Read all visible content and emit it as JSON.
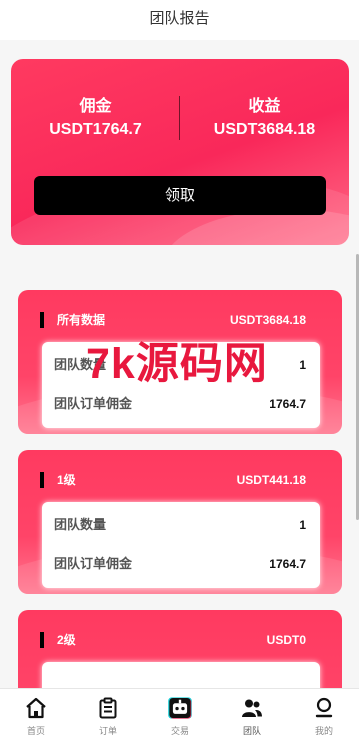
{
  "header": {
    "title": "团队报告"
  },
  "summary": {
    "commission_label": "佣金",
    "commission_value": "USDT1764.7",
    "earnings_label": "收益",
    "earnings_value": "USDT3684.18",
    "claim_label": "领取"
  },
  "cards": [
    {
      "label": "所有数据",
      "amount": "USDT3684.18",
      "rows": [
        {
          "label": "团队数量",
          "value": "1"
        },
        {
          "label": "团队订单佣金",
          "value": "1764.7"
        }
      ]
    },
    {
      "label": "1级",
      "amount": "USDT441.18",
      "rows": [
        {
          "label": "团队数量",
          "value": "1"
        },
        {
          "label": "团队订单佣金",
          "value": "1764.7"
        }
      ]
    },
    {
      "label": "2级",
      "amount": "USDT0",
      "rows": []
    }
  ],
  "watermark": "7k源码网",
  "tabbar": [
    {
      "label": "首页",
      "icon": "home-icon"
    },
    {
      "label": "订单",
      "icon": "clipboard-icon"
    },
    {
      "label": "交易",
      "icon": "robot-icon"
    },
    {
      "label": "团队",
      "icon": "team-icon",
      "active": true
    },
    {
      "label": "我的",
      "icon": "profile-icon"
    }
  ],
  "colors": {
    "accent": "#ff3a60",
    "button": "#000000",
    "background": "#f6f6f6"
  }
}
